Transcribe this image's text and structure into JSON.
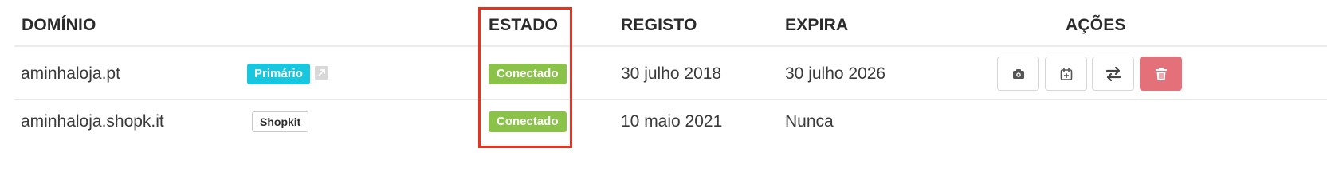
{
  "columns": {
    "domain": "DOMÍNIO",
    "status": "ESTADO",
    "registered": "REGISTO",
    "expires": "EXPIRA",
    "actions": "AÇÕES"
  },
  "rows": [
    {
      "domain": "aminhaloja.pt",
      "tag": "Primário",
      "tag_style": "primary",
      "has_external_link": true,
      "status": "Conectado",
      "registered": "30 julho 2018",
      "expires": "30 julho 2026",
      "actions": [
        "camera-icon",
        "calendar-add-icon",
        "transfer-icon",
        "trash-icon"
      ]
    },
    {
      "domain": "aminhaloja.shopk.it",
      "tag": "Shopkit",
      "tag_style": "outline",
      "has_external_link": false,
      "status": "Conectado",
      "registered": "10 maio 2021",
      "expires": "Nunca",
      "actions": []
    }
  ],
  "colors": {
    "primary_badge": "#17c7df",
    "connected_badge": "#8bc34a",
    "danger_button": "#e4707a",
    "highlight_border": "#e8321e"
  }
}
